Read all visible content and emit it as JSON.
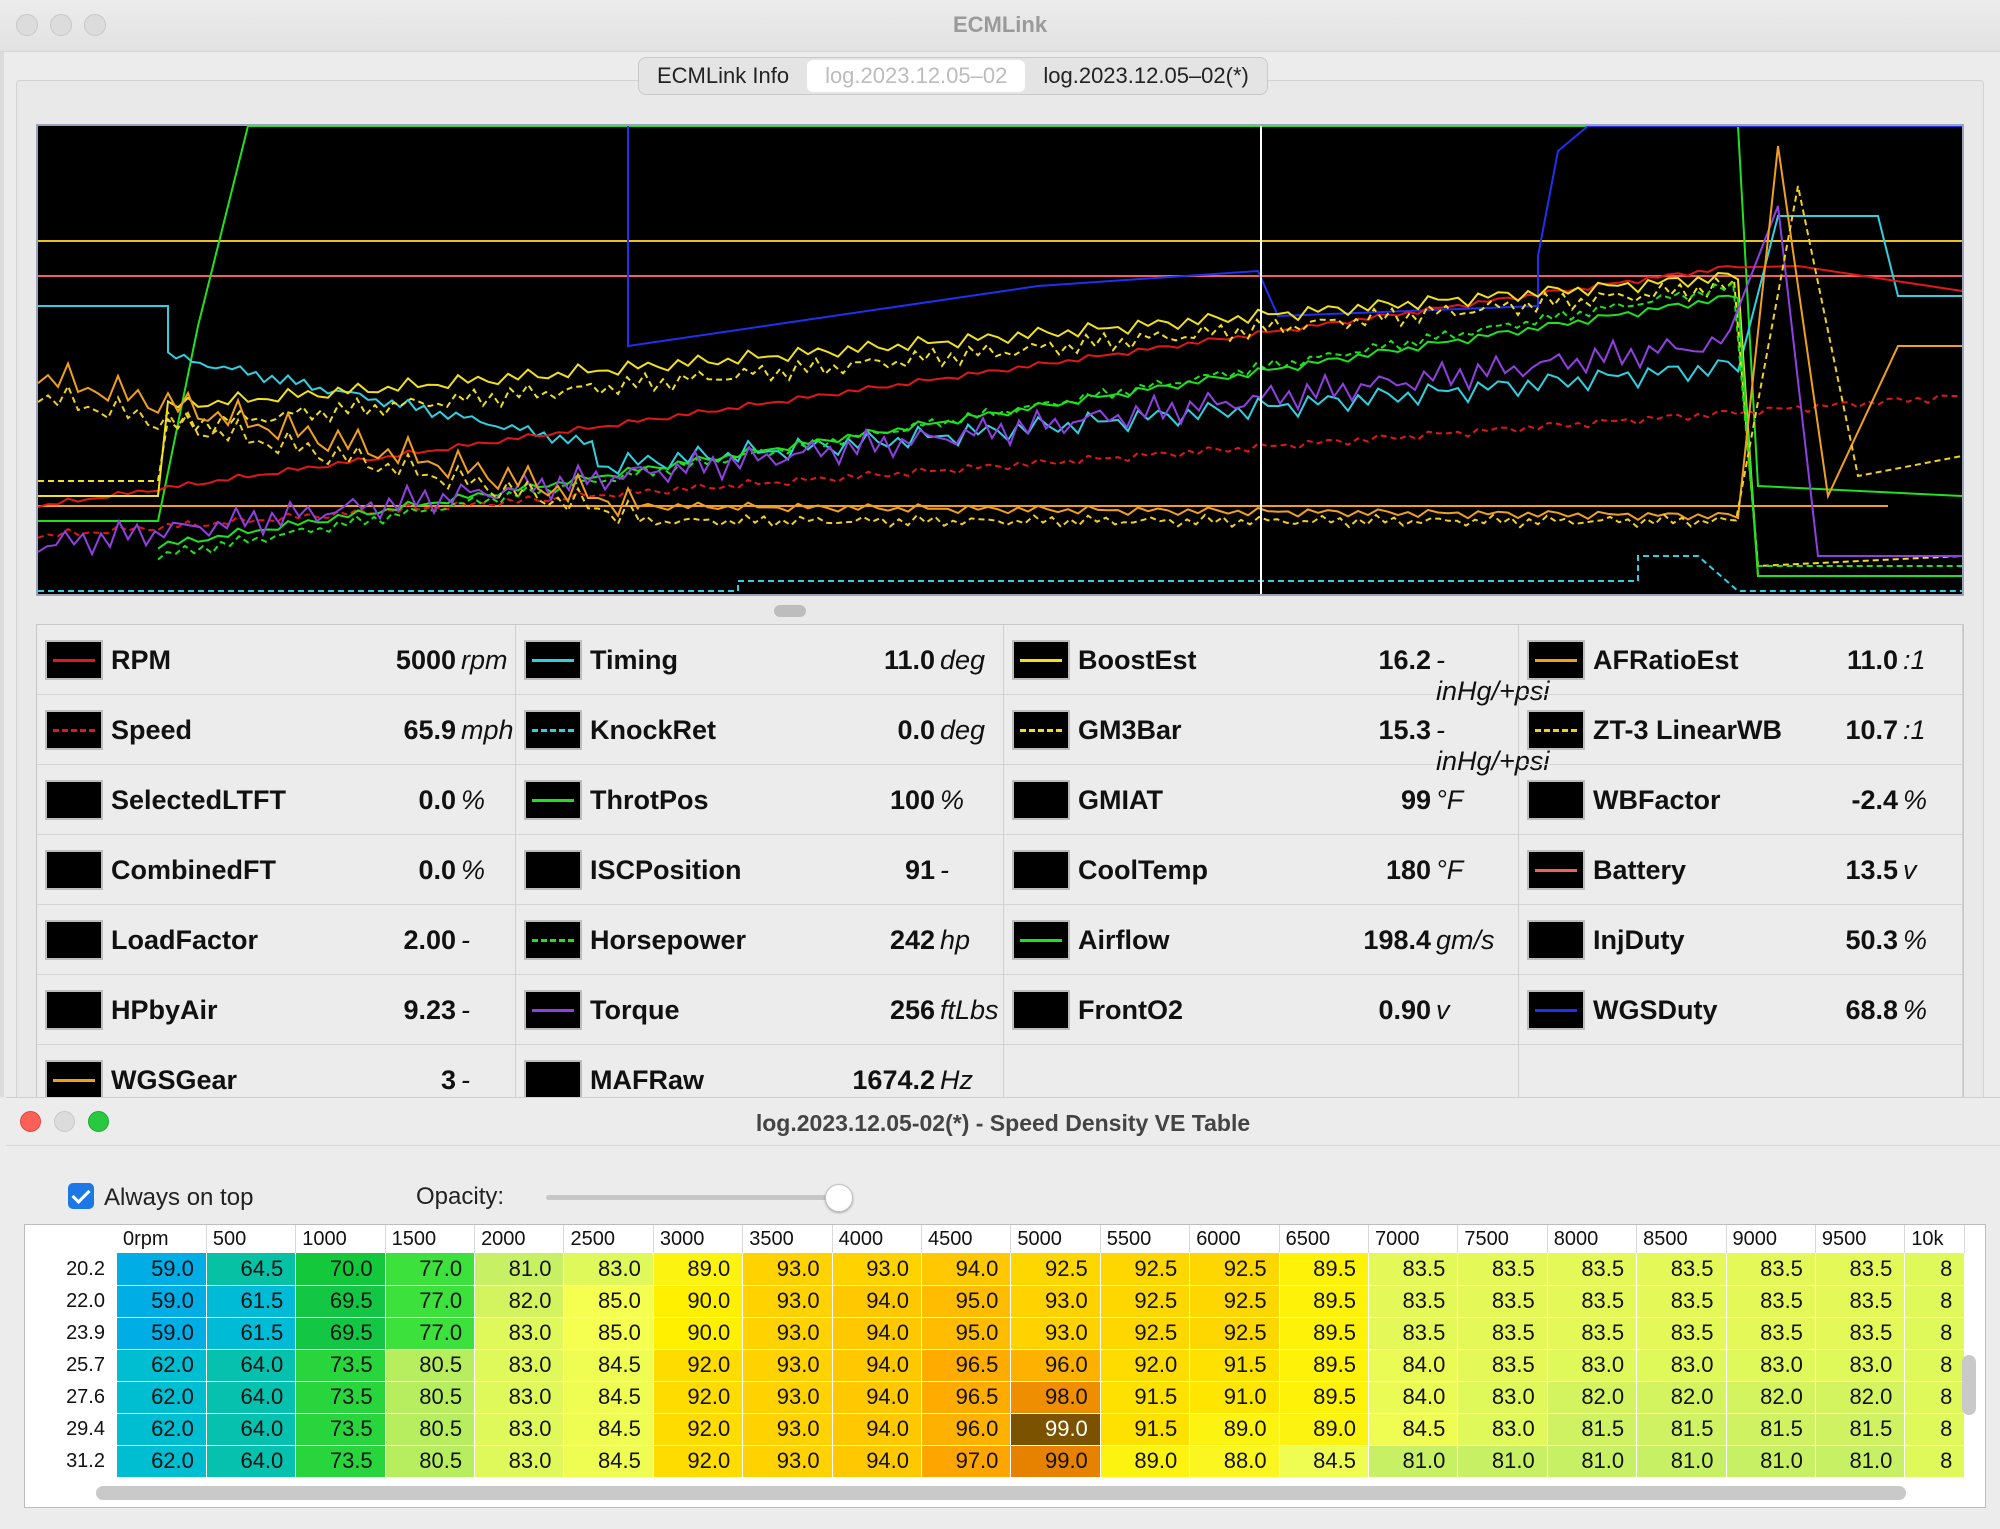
{
  "window": {
    "title": "ECMLink"
  },
  "tabs": [
    {
      "label": "ECMLink Info",
      "selected": false
    },
    {
      "label": "log.2023.12.05–02",
      "selected": true
    },
    {
      "label": "log.2023.12.05–02(*)",
      "selected": false
    }
  ],
  "params": [
    [
      {
        "name": "RPM",
        "value": "5000",
        "unit": "rpm",
        "color": "#e01818",
        "dashed": false
      },
      {
        "name": "Speed",
        "value": "65.9",
        "unit": "mph",
        "color": "#e01818",
        "dashed": true
      },
      {
        "name": "SelectedLTFT",
        "value": "0.0",
        "unit": "%",
        "color": null,
        "dashed": false
      },
      {
        "name": "CombinedFT",
        "value": "0.0",
        "unit": "%",
        "color": null,
        "dashed": false
      },
      {
        "name": "LoadFactor",
        "value": "2.00",
        "unit": "-",
        "color": null,
        "dashed": false
      },
      {
        "name": "HPbyAir",
        "value": "9.23",
        "unit": "-",
        "color": null,
        "dashed": false
      },
      {
        "name": "WGSGear",
        "value": "3",
        "unit": "-",
        "color": "#f0a020",
        "dashed": false
      }
    ],
    [
      {
        "name": "Timing",
        "value": "11.0",
        "unit": "deg",
        "color": "#30d0e0",
        "dashed": false
      },
      {
        "name": "KnockRet",
        "value": "0.0",
        "unit": "deg",
        "color": "#30d0e0",
        "dashed": true
      },
      {
        "name": "ThrotPos",
        "value": "100",
        "unit": "%",
        "color": "#20e020",
        "dashed": false
      },
      {
        "name": "ISCPosition",
        "value": "91",
        "unit": "-",
        "color": null,
        "dashed": false
      },
      {
        "name": "Horsepower",
        "value": "242",
        "unit": "hp",
        "color": "#20e020",
        "dashed": true
      },
      {
        "name": "Torque",
        "value": "256",
        "unit": "ftLbs",
        "color": "#9040e0",
        "dashed": false
      },
      {
        "name": "MAFRaw",
        "value": "1674.2",
        "unit": "Hz",
        "color": null,
        "dashed": false
      }
    ],
    [
      {
        "name": "BoostEst",
        "value": "16.2",
        "unit": "-inHg/+psi",
        "color": "#f0e020",
        "dashed": false
      },
      {
        "name": "GM3Bar",
        "value": "15.3",
        "unit": "-inHg/+psi",
        "color": "#f0e020",
        "dashed": true
      },
      {
        "name": "GMIAT",
        "value": "99",
        "unit": "°F",
        "color": null,
        "dashed": false
      },
      {
        "name": "CoolTemp",
        "value": "180",
        "unit": "°F",
        "color": null,
        "dashed": false
      },
      {
        "name": "Airflow",
        "value": "198.4",
        "unit": "gm/s",
        "color": "#20e020",
        "dashed": false
      },
      {
        "name": "FrontO2",
        "value": "0.90",
        "unit": "v",
        "color": null,
        "dashed": false
      }
    ],
    [
      {
        "name": "AFRatioEst",
        "value": "11.0",
        "unit": ":1",
        "color": "#f0a020",
        "dashed": false
      },
      {
        "name": "ZT-3 LinearWB",
        "value": "10.7",
        "unit": ":1",
        "color": "#f0d020",
        "dashed": true
      },
      {
        "name": "WBFactor",
        "value": "-2.4",
        "unit": "%",
        "color": null,
        "dashed": false
      },
      {
        "name": "Battery",
        "value": "13.5",
        "unit": "v",
        "color": "#f06060",
        "dashed": false
      },
      {
        "name": "InjDuty",
        "value": "50.3",
        "unit": "%",
        "color": null,
        "dashed": false
      },
      {
        "name": "WGSDuty",
        "value": "68.8",
        "unit": "%",
        "color": "#2030f0",
        "dashed": false
      }
    ]
  ],
  "ve": {
    "title": "log.2023.12.05-02(*) - Speed Density VE Table",
    "always_on_top_label": "Always on top",
    "always_on_top_checked": true,
    "opacity_label": "Opacity:",
    "opacity": 1.0,
    "columns": [
      "0rpm",
      "500",
      "1000",
      "1500",
      "2000",
      "2500",
      "3000",
      "3500",
      "4000",
      "4500",
      "5000",
      "5500",
      "6000",
      "6500",
      "7000",
      "7500",
      "8000",
      "8500",
      "9000",
      "9500",
      "10k"
    ],
    "rows": [
      {
        "label": "20.2",
        "values": [
          "59.0",
          "64.5",
          "70.0",
          "77.0",
          "81.0",
          "83.0",
          "89.0",
          "93.0",
          "93.0",
          "94.0",
          "92.5",
          "92.5",
          "92.5",
          "89.5",
          "83.5",
          "83.5",
          "83.5",
          "83.5",
          "83.5",
          "83.5",
          "8"
        ]
      },
      {
        "label": "22.0",
        "values": [
          "59.0",
          "61.5",
          "69.5",
          "77.0",
          "82.0",
          "85.0",
          "90.0",
          "93.0",
          "94.0",
          "95.0",
          "93.0",
          "92.5",
          "92.5",
          "89.5",
          "83.5",
          "83.5",
          "83.5",
          "83.5",
          "83.5",
          "83.5",
          "8"
        ]
      },
      {
        "label": "23.9",
        "values": [
          "59.0",
          "61.5",
          "69.5",
          "77.0",
          "83.0",
          "85.0",
          "90.0",
          "93.0",
          "94.0",
          "95.0",
          "93.0",
          "92.5",
          "92.5",
          "89.5",
          "83.5",
          "83.5",
          "83.5",
          "83.5",
          "83.5",
          "83.5",
          "8"
        ]
      },
      {
        "label": "25.7",
        "values": [
          "62.0",
          "64.0",
          "73.5",
          "80.5",
          "83.0",
          "84.5",
          "92.0",
          "93.0",
          "94.0",
          "96.5",
          "96.0",
          "92.0",
          "91.5",
          "89.5",
          "84.0",
          "83.5",
          "83.0",
          "83.0",
          "83.0",
          "83.0",
          "8"
        ]
      },
      {
        "label": "27.6",
        "values": [
          "62.0",
          "64.0",
          "73.5",
          "80.5",
          "83.0",
          "84.5",
          "92.0",
          "93.0",
          "94.0",
          "96.5",
          "98.0",
          "91.5",
          "91.0",
          "89.5",
          "84.0",
          "83.0",
          "82.0",
          "82.0",
          "82.0",
          "82.0",
          "8"
        ]
      },
      {
        "label": "29.4",
        "values": [
          "62.0",
          "64.0",
          "73.5",
          "80.5",
          "83.0",
          "84.5",
          "92.0",
          "93.0",
          "94.0",
          "96.0",
          "99.0",
          "91.5",
          "89.0",
          "89.0",
          "84.5",
          "83.0",
          "81.5",
          "81.5",
          "81.5",
          "81.5",
          "8"
        ]
      },
      {
        "label": "31.2",
        "values": [
          "62.0",
          "64.0",
          "73.5",
          "80.5",
          "83.0",
          "84.5",
          "92.0",
          "93.0",
          "94.0",
          "97.0",
          "99.0",
          "89.0",
          "88.0",
          "84.5",
          "81.0",
          "81.0",
          "81.0",
          "81.0",
          "81.0",
          "81.0",
          "8"
        ]
      }
    ],
    "selected_cell": {
      "row": 5,
      "col": 10
    }
  }
}
